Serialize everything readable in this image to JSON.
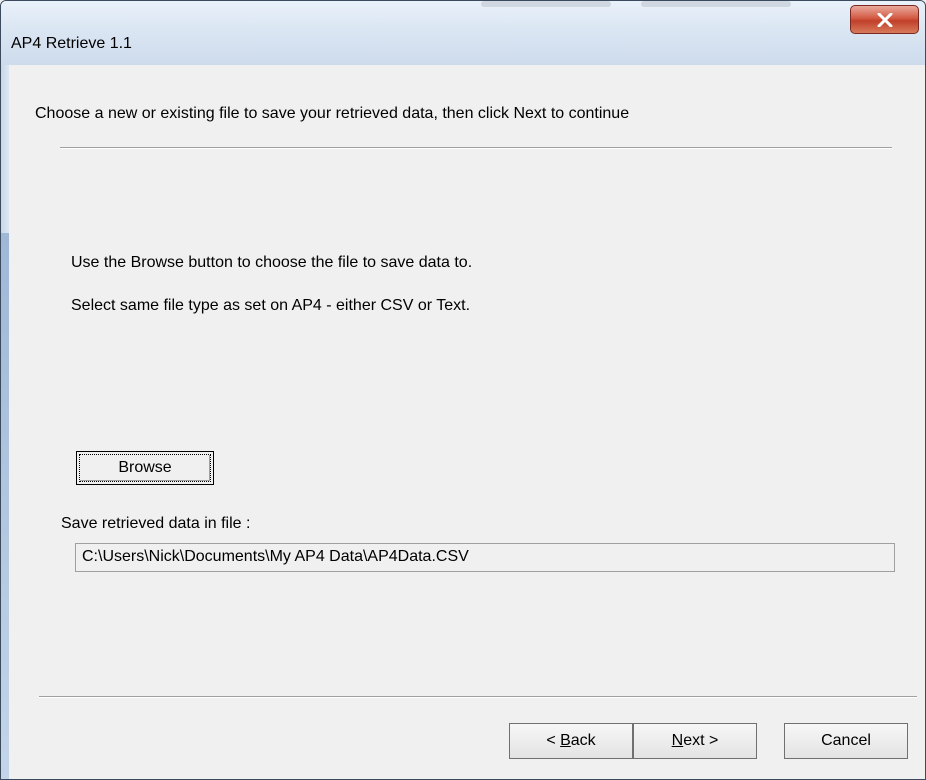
{
  "window": {
    "title": "AP4 Retrieve 1.1"
  },
  "titlebar": {
    "close_icon": "close-icon"
  },
  "content": {
    "instruction": "Choose a new or existing file to save your retrieved data, then click Next to continue",
    "line1": "Use the Browse button to choose the file to save data to.",
    "line2": "Select same file type as set on AP4 - either CSV or Text.",
    "browse_label": "Browse",
    "save_label": "Save retrieved data in file :",
    "file_path": "C:\\Users\\Nick\\Documents\\My AP4 Data\\AP4Data.CSV"
  },
  "buttons": {
    "back": {
      "prefix": "< ",
      "accel": "B",
      "rest": "ack"
    },
    "next": {
      "accel": "N",
      "rest": "ext >"
    },
    "cancel": "Cancel"
  },
  "colors": {
    "close_button": "#c1402a",
    "background": "#f0f0f0"
  }
}
